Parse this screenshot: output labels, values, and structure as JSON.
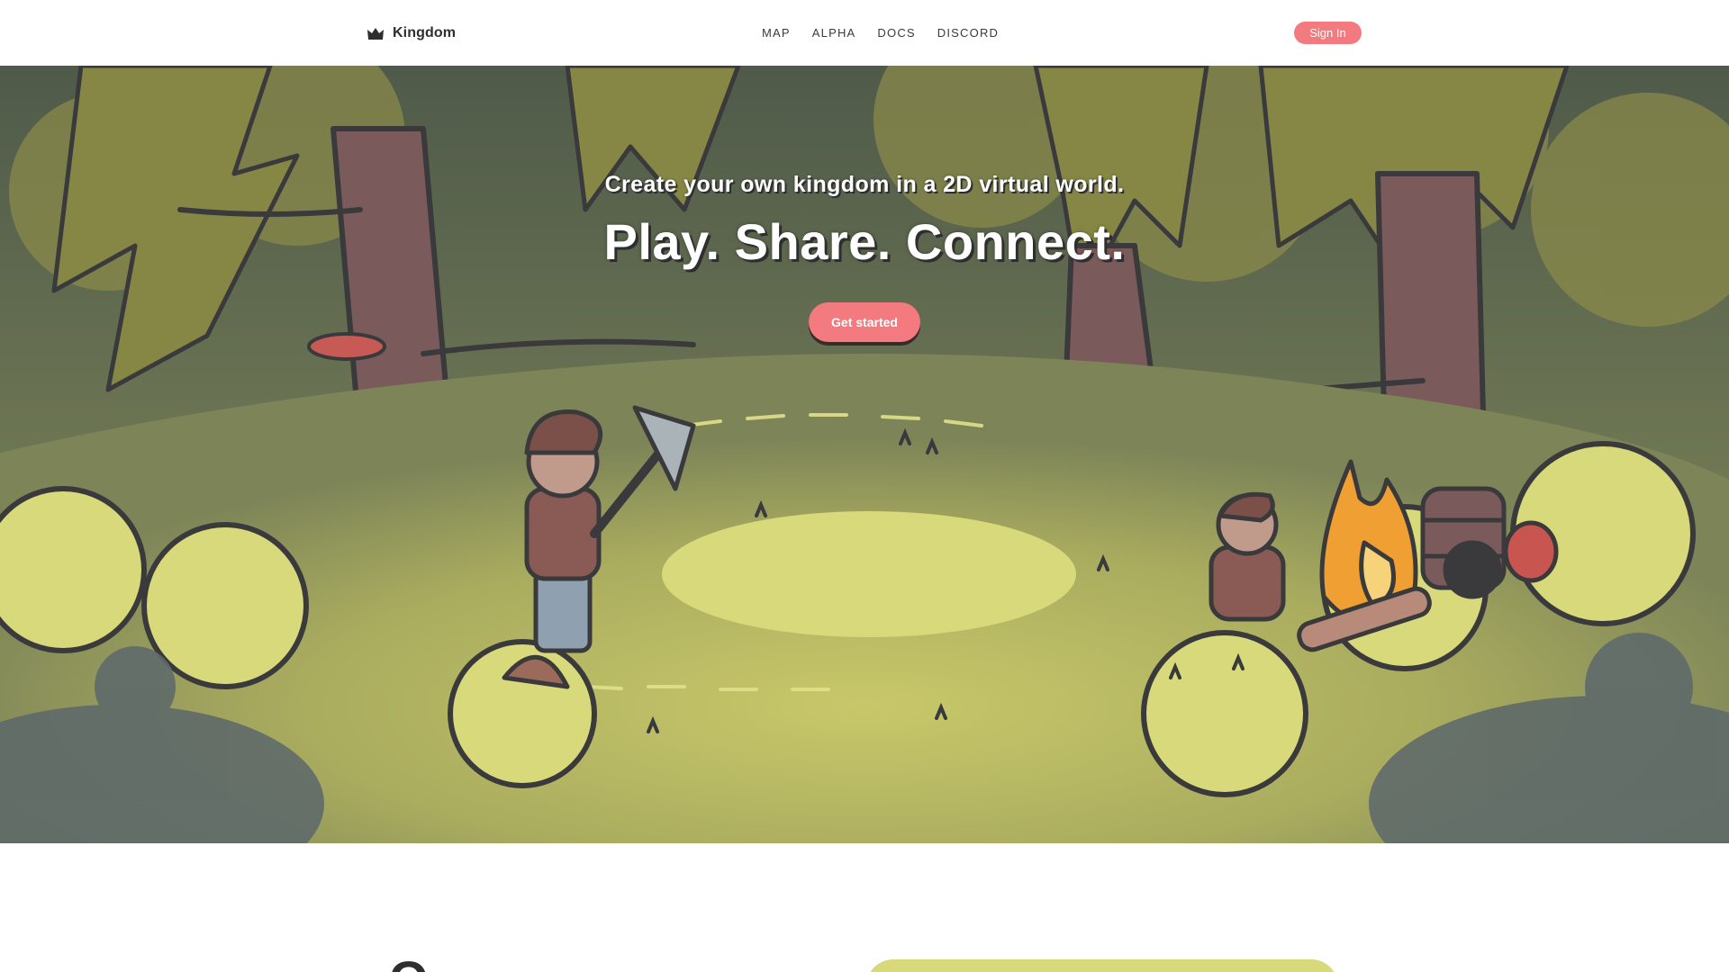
{
  "nav": {
    "brand": "Kingdom",
    "brand_icon": "crown-icon",
    "links": [
      "MAP",
      "ALPHA",
      "DOCS",
      "DISCORD"
    ],
    "signin_label": "Sign In"
  },
  "hero": {
    "tagline": "Create your own kingdom in a 2D virtual world.",
    "headline": "Play. Share. Connect.",
    "cta_label": "Get started"
  },
  "below": {
    "heading_partial": "O"
  },
  "colors": {
    "accent": "#f37a7e",
    "outline": "#3a3a3d",
    "grass_light": "#d8d97a",
    "grass_mid": "#a9ac5e",
    "foliage_dark": "#5f6a50",
    "trunk": "#7a5a5a",
    "fire": "#f0a032"
  }
}
